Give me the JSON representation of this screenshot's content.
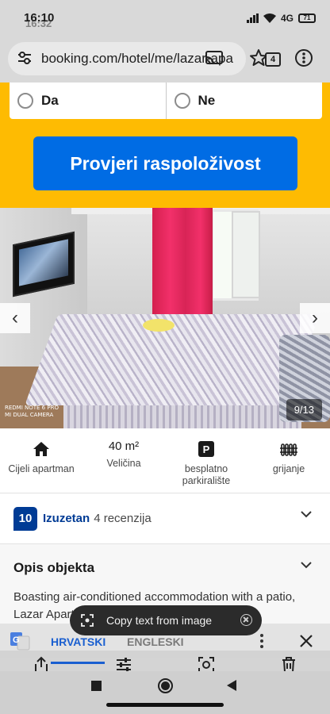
{
  "status_bar": {
    "time": "16:10",
    "time_ghost": "16:32",
    "network": "4G",
    "battery": "71"
  },
  "browser": {
    "url": "booking.com/hotel/me/lazar-apa",
    "tab_count": "4"
  },
  "booking_form": {
    "option_yes": "Da",
    "option_no": "Ne",
    "availability_button": "Provjeri raspoloživost"
  },
  "gallery": {
    "counter": "9/13",
    "watermark_line1": "REDMI NOTE 6 PRO",
    "watermark_line2": "MI DUAL CAMERA",
    "prev_arrow": "‹",
    "next_arrow": "›"
  },
  "facilities": [
    {
      "icon": "home-icon",
      "value": "",
      "label": "Cijeli apartman"
    },
    {
      "icon": "",
      "value": "40 m²",
      "label": "Veličina"
    },
    {
      "icon": "parking-icon",
      "value": "",
      "label": "besplatno parkiralište"
    },
    {
      "icon": "heater-icon",
      "value": "",
      "label": "grijanje"
    }
  ],
  "reviews": {
    "score": "10",
    "rating_word": "Izuzetan",
    "count_text": "4 recenzija"
  },
  "description": {
    "title": "Opis objekta",
    "text": "Boasting air-conditioned accommodation with a patio, Lazar Apartman is set in Tivat. This"
  },
  "toast": {
    "label": "Copy text from image"
  },
  "translate_bar": {
    "source_language": "HRVATSKI",
    "target_language": "ENGLESKI"
  },
  "colors": {
    "brand_yellow": "#febb02",
    "brand_blue": "#006ce4",
    "score_blue": "#003b95",
    "curtain_red": "#e8285e"
  }
}
